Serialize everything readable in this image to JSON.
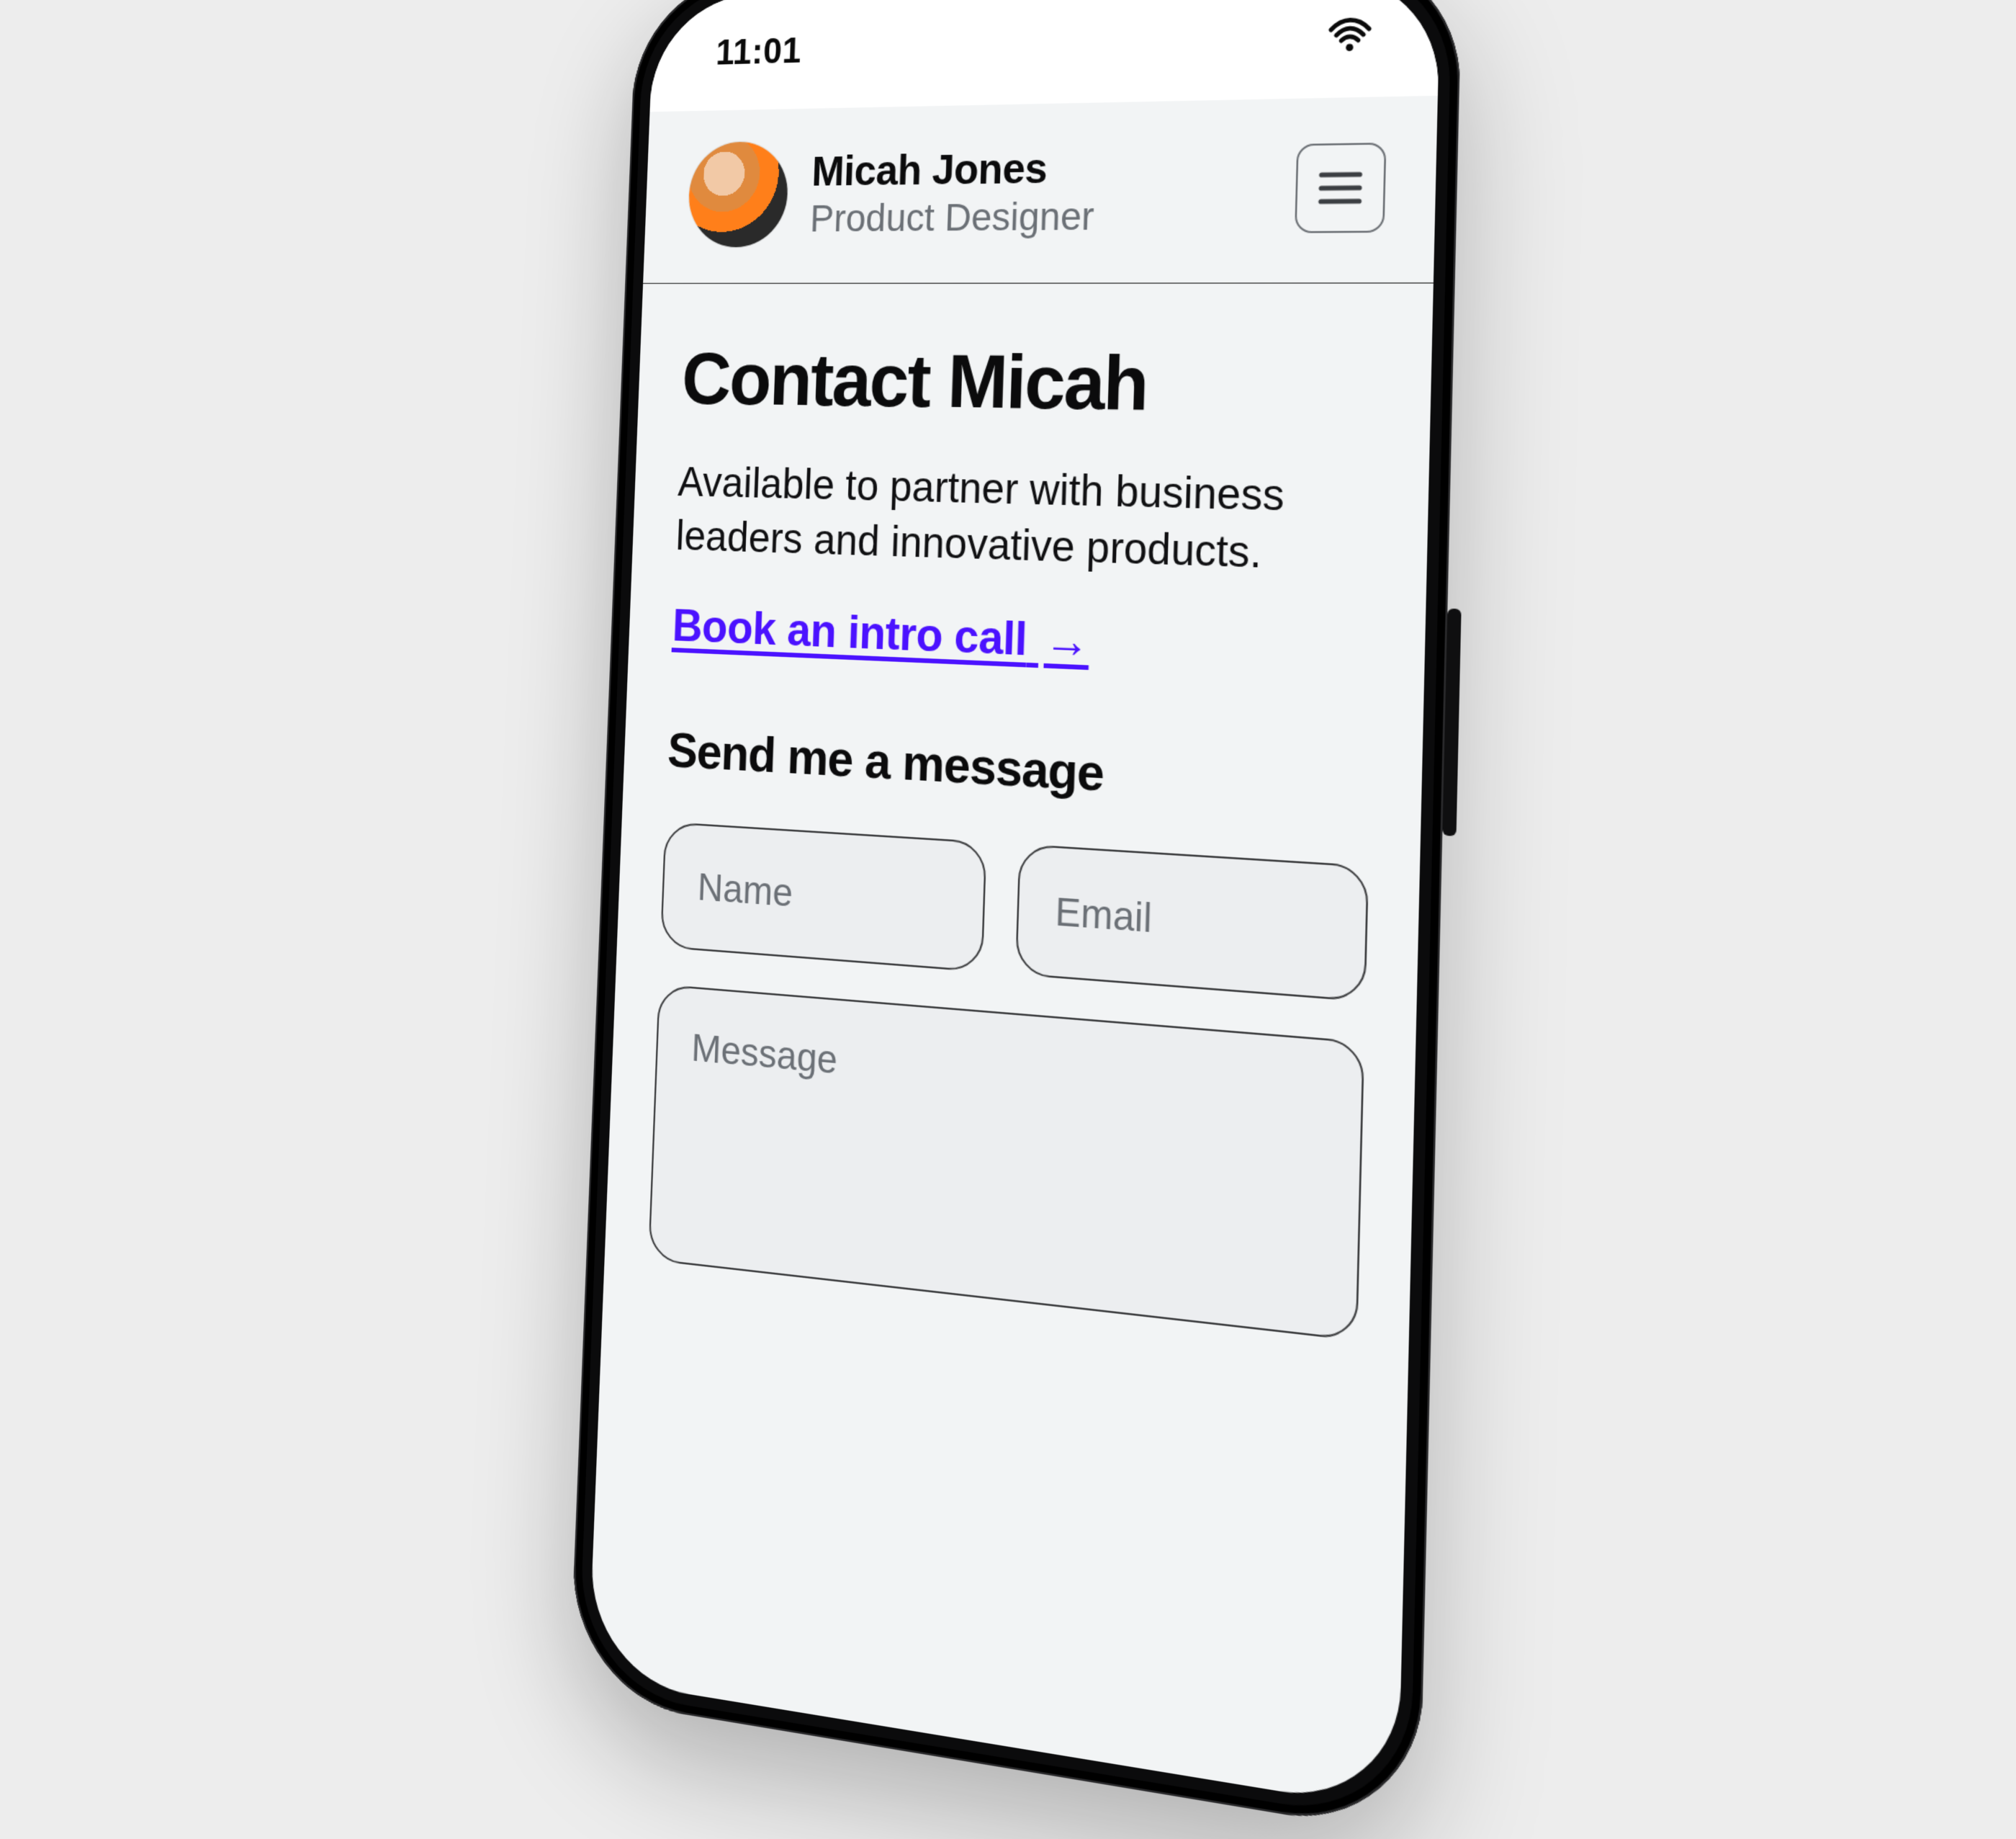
{
  "status": {
    "time": "11:01"
  },
  "header": {
    "name": "Micah Jones",
    "role": "Product Designer"
  },
  "page": {
    "title": "Contact Micah",
    "description": "Available to partner with business leaders and innovative products.",
    "intro_link": "Book an intro call",
    "intro_link_arrow": "→",
    "form_heading": "Send me a message"
  },
  "form": {
    "name_placeholder": "Name",
    "email_placeholder": "Email",
    "message_placeholder": "Message"
  },
  "icons": {
    "wifi": "wifi-icon",
    "menu": "hamburger-icon"
  },
  "colors": {
    "link": "#4b12ff",
    "text": "#0b0b0c",
    "muted": "#6b7076",
    "border": "#3e3f41",
    "page_bg": "#ededed",
    "screen_bg": "#f2f4f5"
  }
}
